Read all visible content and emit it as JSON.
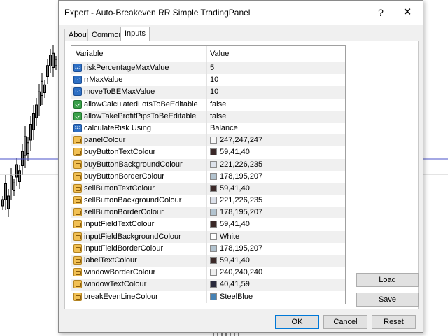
{
  "dialog": {
    "title": "Expert - Auto-Breakeven RR Simple TradingPanel",
    "help_glyph": "?",
    "close_glyph": "✕"
  },
  "tabs": [
    {
      "label": "About",
      "active": false
    },
    {
      "label": "Common",
      "active": false
    },
    {
      "label": "Inputs",
      "active": true
    }
  ],
  "grid": {
    "headers": {
      "variable": "Variable",
      "value": "Value"
    },
    "rows": [
      {
        "icon": "numeric-icon",
        "name": "riskPercentageMaxValue",
        "value": "5"
      },
      {
        "icon": "numeric-icon",
        "name": "rrMaxValue",
        "value": "10"
      },
      {
        "icon": "numeric-icon",
        "name": "moveToBEMaxValue",
        "value": "10"
      },
      {
        "icon": "boolean-icon",
        "name": "allowCalculatedLotsToBeEditable",
        "value": "false"
      },
      {
        "icon": "boolean-icon",
        "name": "allowTakeProfitPipsToBeEditable",
        "value": "false"
      },
      {
        "icon": "numeric-icon",
        "name": "calculateRisk Using",
        "value": "Balance"
      },
      {
        "icon": "color-icon",
        "name": "panelColour",
        "value": "247,247,247",
        "swatch": "#f7f7f7"
      },
      {
        "icon": "color-icon",
        "name": "buyButtonTextColour",
        "value": "59,41,40",
        "swatch": "#3b2928"
      },
      {
        "icon": "color-icon",
        "name": "buyButtonBackgroundColour",
        "value": "221,226,235",
        "swatch": "#dde2eb"
      },
      {
        "icon": "color-icon",
        "name": "buyButtonBorderColour",
        "value": "178,195,207",
        "swatch": "#b2c3cf"
      },
      {
        "icon": "color-icon",
        "name": "sellButtonTextColour",
        "value": "59,41,40",
        "swatch": "#3b2928"
      },
      {
        "icon": "color-icon",
        "name": "sellButtonBackgroundColour",
        "value": "221,226,235",
        "swatch": "#dde2eb"
      },
      {
        "icon": "color-icon",
        "name": "sellButtonBorderColour",
        "value": "178,195,207",
        "swatch": "#b2c3cf"
      },
      {
        "icon": "color-icon",
        "name": "inputFieldTextColour",
        "value": "59,41,40",
        "swatch": "#3b2928"
      },
      {
        "icon": "color-icon",
        "name": "inputFieldBackgroundColour",
        "value": "White",
        "swatch": "#ffffff"
      },
      {
        "icon": "color-icon",
        "name": "inputFieldBorderColour",
        "value": "178,195,207",
        "swatch": "#b2c3cf"
      },
      {
        "icon": "color-icon",
        "name": "labelTextColour",
        "value": "59,41,40",
        "swatch": "#3b2928"
      },
      {
        "icon": "color-icon",
        "name": "windowBorderColour",
        "value": "240,240,240",
        "swatch": "#f0f0f0"
      },
      {
        "icon": "color-icon",
        "name": "windowTextColour",
        "value": "40,41,59",
        "swatch": "#28293b"
      },
      {
        "icon": "color-icon",
        "name": "breakEvenLineColour",
        "value": "SteelBlue",
        "swatch": "#4682b4"
      }
    ]
  },
  "side_buttons": {
    "load": "Load",
    "save": "Save"
  },
  "bottom_buttons": {
    "ok": "OK",
    "cancel": "Cancel",
    "reset": "Reset"
  },
  "colors": {
    "chart_line": "#4a52c8",
    "candle": "#000000",
    "accent": "#0078d7"
  }
}
